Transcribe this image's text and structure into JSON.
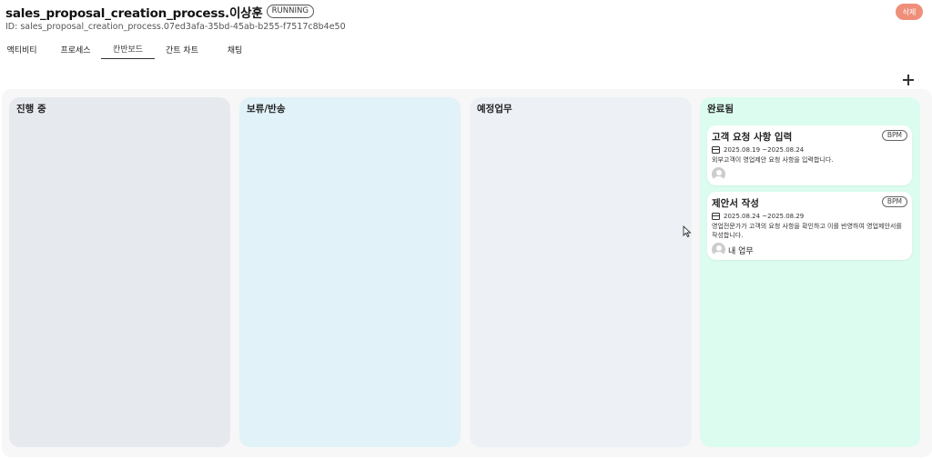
{
  "header": {
    "title": "sales_proposal_creation_process.이상훈",
    "status": "RUNNING",
    "process_id": "ID: sales_proposal_creation_process.07ed3afa-35bd-45ab-b255-f7517c8b4e50",
    "delete_label": "삭제"
  },
  "tabs": [
    {
      "label": "액티비티"
    },
    {
      "label": "프로세스"
    },
    {
      "label": "칸반보드",
      "active": true
    },
    {
      "label": "간트 차트"
    },
    {
      "label": "채팅"
    }
  ],
  "toolbar": {
    "add_icon": "plus-icon"
  },
  "columns": [
    {
      "title": "진행 중",
      "color": "#e6e9ee",
      "cards": []
    },
    {
      "title": "보류/반송",
      "color": "#e1f2f8",
      "cards": []
    },
    {
      "title": "예정업무",
      "color": "#edf1f6",
      "cards": []
    },
    {
      "title": "완료됨",
      "color": "#dbfcef",
      "cards": [
        {
          "title": "고객 요청 사항 입력",
          "tag": "BPM",
          "date": "2025.08.19 ~2025.08.24",
          "desc": "외부고객이 영업제안 요청 사항을 입력합니다.",
          "assignee": ""
        },
        {
          "title": "제안서 작성",
          "tag": "BPM",
          "date": "2025.08.24 ~2025.08.29",
          "desc": "영업전문가가 고객의 요청 사항을 확인하고 이를 반영하여 영업제안서를 작성합니다.",
          "assignee": "내 업무"
        }
      ]
    }
  ],
  "colors": {
    "delete_button": "#ef8f7a",
    "board_bg": "#f7f7f8"
  }
}
